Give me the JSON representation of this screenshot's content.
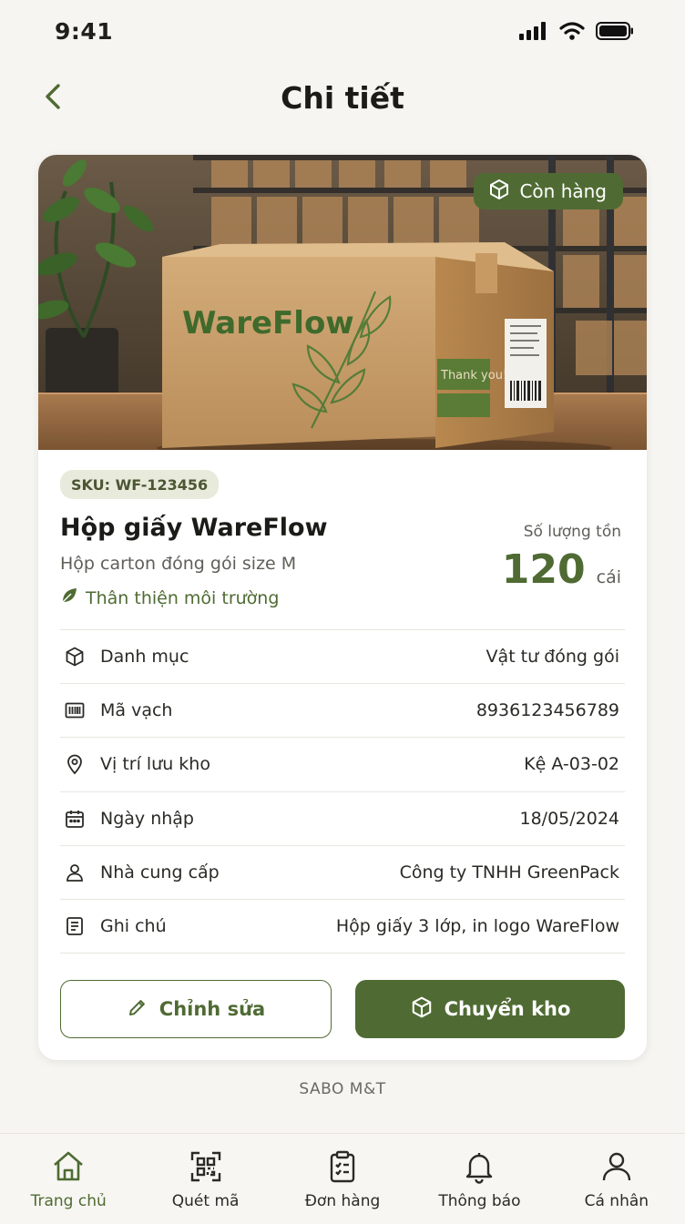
{
  "status_bar": {
    "time": "9:41"
  },
  "header": {
    "title": "Chi tiết"
  },
  "product": {
    "image_box_brand": "WareFlow",
    "image_box_sticker": "Thank you!",
    "stock_badge": "Còn hàng",
    "sku": "SKU: WF-123456",
    "name": "Hộp giấy WareFlow",
    "description": "Hộp carton đóng gói size M",
    "eco_tag": "Thân thiện môi trường",
    "quantity_label": "Số lượng tồn",
    "quantity": "120",
    "unit": "cái"
  },
  "details": [
    {
      "icon": "box-icon",
      "label": "Danh mục",
      "value": "Vật tư đóng gói"
    },
    {
      "icon": "barcode-icon",
      "label": "Mã vạch",
      "value": "8936123456789"
    },
    {
      "icon": "location-pin-icon",
      "label": "Vị trí lưu kho",
      "value": "Kệ A-03-02"
    },
    {
      "icon": "calendar-icon",
      "label": "Ngày nhập",
      "value": "18/05/2024"
    },
    {
      "icon": "user-icon",
      "label": "Nhà cung cấp",
      "value": "Công ty TNHH GreenPack"
    },
    {
      "icon": "note-icon",
      "label": "Ghi chú",
      "value": "Hộp giấy 3 lớp, in logo WareFlow"
    }
  ],
  "actions": {
    "edit_label": "Chỉnh sửa",
    "transfer_label": "Chuyển kho"
  },
  "footer": {
    "brand": "SABO M&T"
  },
  "nav": [
    {
      "icon": "home-icon",
      "label": "Trang chủ",
      "active": true
    },
    {
      "icon": "scan-icon",
      "label": "Quét mã",
      "active": false
    },
    {
      "icon": "clipboard-icon",
      "label": "Đơn hàng",
      "active": false
    },
    {
      "icon": "bell-icon",
      "label": "Thông báo",
      "active": false
    },
    {
      "icon": "profile-icon",
      "label": "Cá nhân",
      "active": false
    }
  ],
  "colors": {
    "accent": "#4f6b33",
    "background": "#f6f5f1",
    "card": "#ffffff",
    "text": "#1f1f1c"
  }
}
